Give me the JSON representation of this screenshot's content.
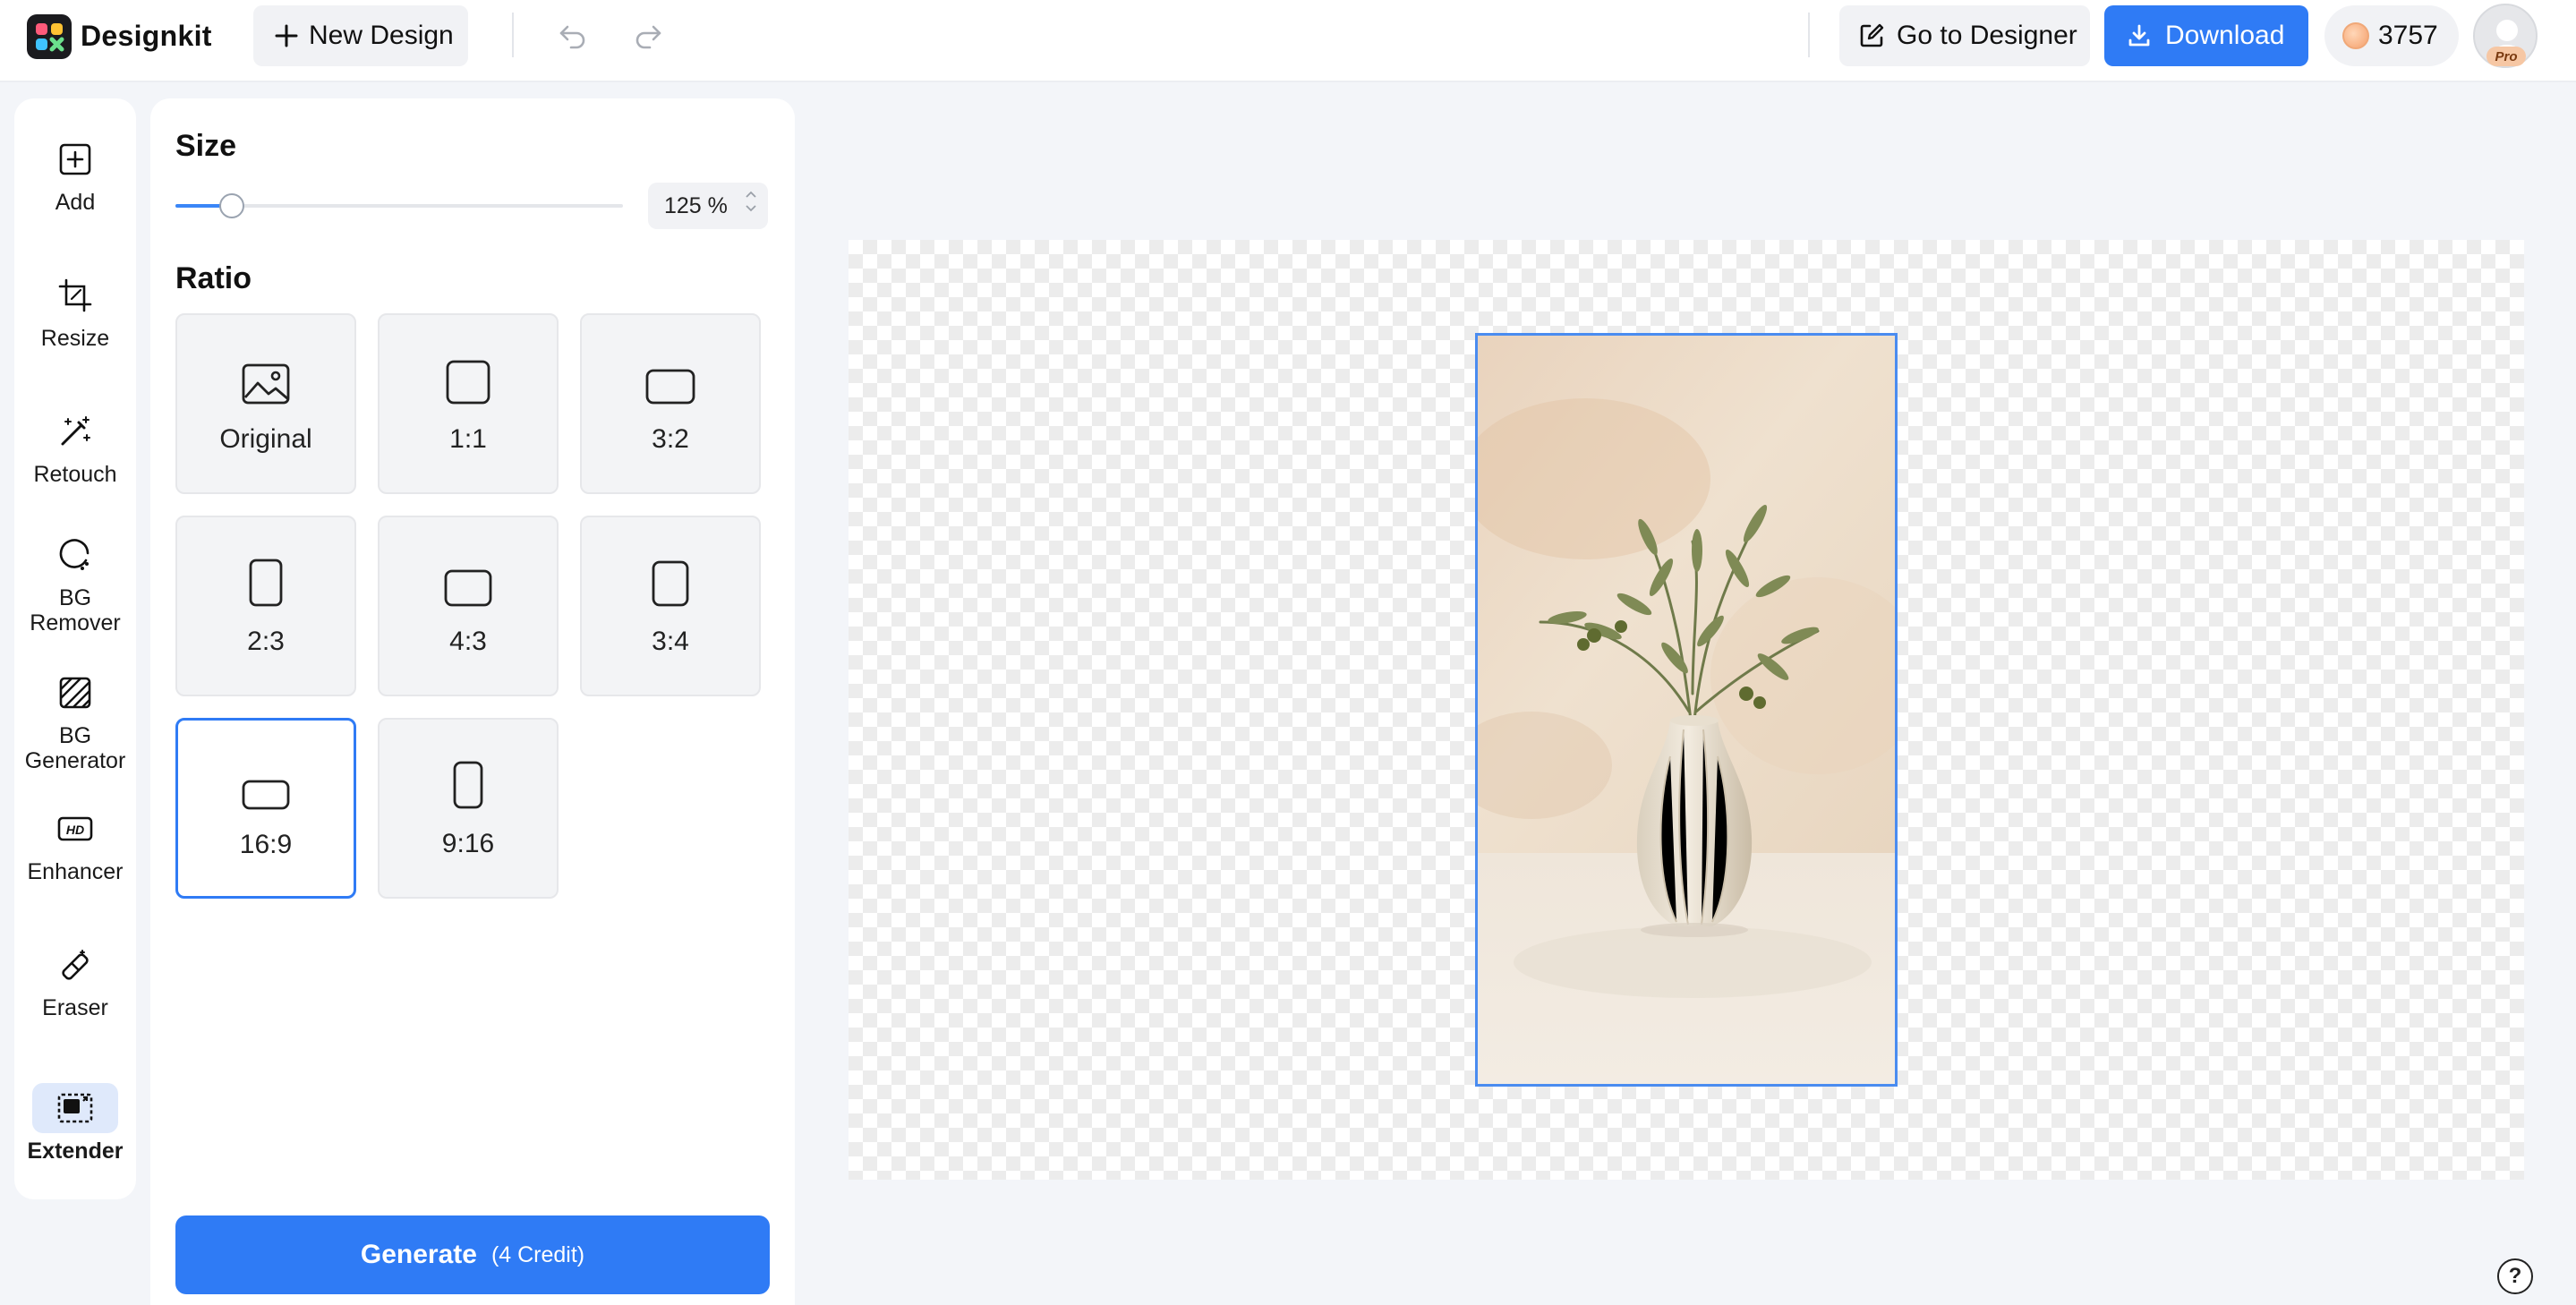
{
  "app": {
    "brand": "Designkit"
  },
  "toolbar": {
    "new_design_label": "New Design",
    "go_to_designer_label": "Go to Designer",
    "download_label": "Download",
    "credits": "3757",
    "pro_badge": "Pro"
  },
  "rail": {
    "items": [
      {
        "label": "Add",
        "icon": "add-square-icon"
      },
      {
        "label": "Resize",
        "icon": "crop-icon"
      },
      {
        "label": "Retouch",
        "icon": "magic-wand-icon"
      },
      {
        "label": "BG Remover",
        "icon": "bg-remover-icon"
      },
      {
        "label": "BG Generator",
        "icon": "bg-generator-icon"
      },
      {
        "label": "Enhancer",
        "icon": "hd-icon"
      },
      {
        "label": "Eraser",
        "icon": "eraser-icon"
      },
      {
        "label": "Extender",
        "icon": "extender-icon"
      }
    ],
    "active": "Extender"
  },
  "panel": {
    "size_title": "Size",
    "size_value": "125 %",
    "size_slider_fraction": 0.125,
    "ratio_title": "Ratio",
    "ratios": [
      {
        "label": "Original",
        "icon": "image-icon"
      },
      {
        "label": "1:1",
        "icon": "ratio-1-1-icon"
      },
      {
        "label": "3:2",
        "icon": "ratio-3-2-icon"
      },
      {
        "label": "2:3",
        "icon": "ratio-2-3-icon"
      },
      {
        "label": "4:3",
        "icon": "ratio-4-3-icon"
      },
      {
        "label": "3:4",
        "icon": "ratio-3-4-icon"
      },
      {
        "label": "16:9",
        "icon": "ratio-16-9-icon"
      },
      {
        "label": "9:16",
        "icon": "ratio-9-16-icon"
      }
    ],
    "selected_ratio": "16:9",
    "generate_label": "Generate",
    "generate_cost": "(4 Credit)"
  },
  "colors": {
    "accent": "#2f7bf5",
    "selection_border": "#4a8cf0"
  }
}
